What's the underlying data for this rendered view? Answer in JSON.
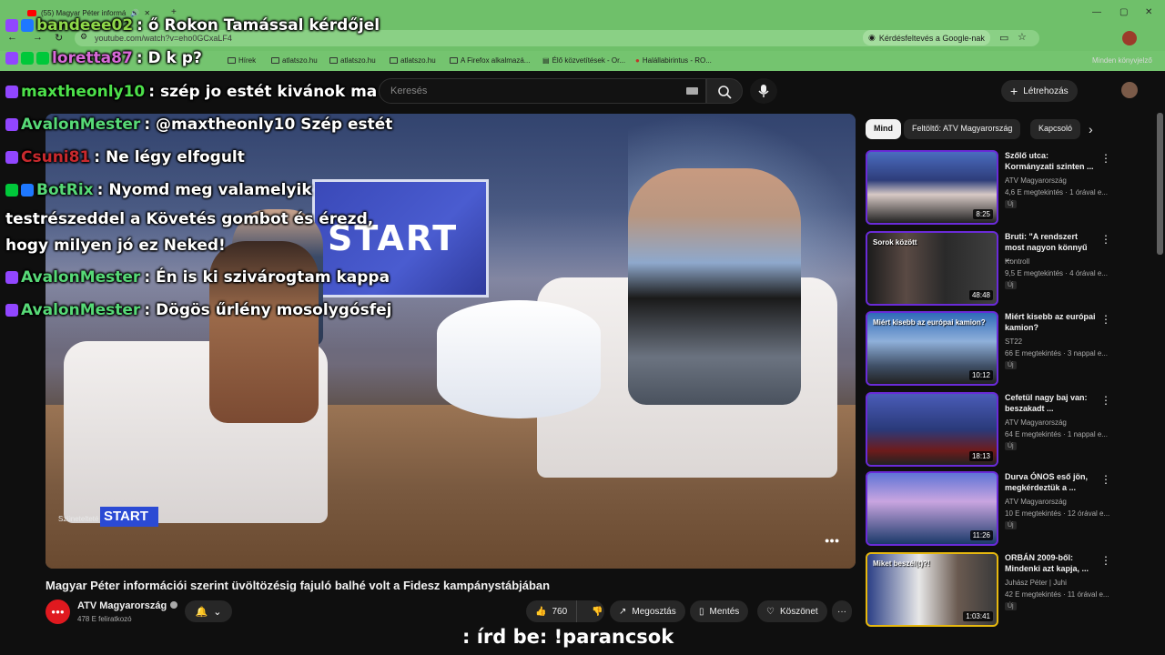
{
  "browser": {
    "tab_title": "(55) Magyar Péter informá",
    "url": "youtube.com/watch?v=eho0GCxaLF4",
    "google_chip": "Kérdésfeltevés a Google-nak",
    "bookmarks": [
      "Hírek",
      "atlatszo.hu",
      "atlatszo.hu",
      "atlatszo.hu",
      "A Firefox alkalmazá...",
      "Élő közvetítések - Or...",
      "Halállabirintus - RO..."
    ],
    "other_bookmarks": "Minden könyvjelző"
  },
  "youtube": {
    "search_placeholder": "Keresés",
    "create_label": "Létrehozás"
  },
  "chat": [
    {
      "user": "bandeee02",
      "message": ": ő Rokon Tamással kérdőjel",
      "user_color": "#8fd94a"
    },
    {
      "user": "loretta87",
      "message": ": D k p?",
      "user_color": "#d86ad8"
    },
    {
      "user": "maxtheonly10",
      "message": ": szép jo estét kivánok ma",
      "user_color": "#4de04a"
    },
    {
      "user": "AvalonMester",
      "message": ": @maxtheonly10 Szép estét",
      "user_color": "#57d977"
    },
    {
      "user": "Csuni81",
      "message": ": Ne légy elfogult",
      "user_color": "#c8292d"
    },
    {
      "user": "BotRix",
      "message": ": Nyomd meg valamelyik",
      "user_color": "#57d977"
    }
  ],
  "chat_wrap_lines": [
    "testrészeddel a Követés gombot és érezd,",
    "hogy milyen jó ez Neked!"
  ],
  "chat_tail": [
    {
      "user": "AvalonMester",
      "message": ": Én is ki szivárogtam kappa"
    },
    {
      "user": "AvalonMester",
      "message": ": Dögös űrlény mosolygósfej"
    }
  ],
  "video": {
    "screen_logo": "START",
    "badge": "START",
    "pause_text": "Szünetelteté",
    "title": "Magyar Péter információi szerint üvöltözésig fajuló balhé volt a Fidesz kampánystábjában",
    "channel": "ATV Magyarország",
    "subscribers": "478 E feliratkozó",
    "likes": "760",
    "share": "Megosztás",
    "save": "Mentés",
    "thanks": "Köszönet"
  },
  "overlay_command": ": írd be: !parancsok",
  "sidebar": {
    "chips": [
      "Mind",
      "Feltöltő: ATV Magyarország",
      "Kapcsoló"
    ],
    "recommendations": [
      {
        "title": "Szőlő utca: Kormányzati szinten ...",
        "channel": "ATV Magyarország",
        "meta": "4,6 E megtekintés · 1 órával e...",
        "duration": "8:25",
        "new": "Új",
        "thumb_text": ""
      },
      {
        "title": "Bruti: \"A rendszert most nagyon könnyű ...",
        "channel": "Kontroll",
        "meta": "9,5 E megtekintés · 4 órával e...",
        "duration": "48:48",
        "new": "Új",
        "thumb_text": "Sorok között"
      },
      {
        "title": "Miért kisebb az európai kamion?",
        "channel": "ST22",
        "meta": "66 E megtekintés · 3 nappal e...",
        "duration": "10:12",
        "new": "Új",
        "thumb_text": "Miért kisebb az európai kamion?"
      },
      {
        "title": "Cefetül nagy baj van: beszakadt ...",
        "channel": "ATV Magyarország",
        "meta": "64 E megtekintés · 1 nappal e...",
        "duration": "18:13",
        "new": "Új",
        "thumb_text": ""
      },
      {
        "title": "Durva ÓNOS eső jön, megkérdeztük a ...",
        "channel": "ATV Magyarország",
        "meta": "10 E megtekintés · 12 órával e...",
        "duration": "11:26",
        "new": "Új",
        "thumb_text": ""
      },
      {
        "title": "ORBÁN 2009-ből: Mindenki azt kapja, ...",
        "channel": "Juhász Péter | Juhi",
        "meta": "42 E megtekintés · 11 órával e...",
        "duration": "1:03:41",
        "new": "Új",
        "thumb_text": "Miket beszél(t)?!"
      }
    ]
  }
}
